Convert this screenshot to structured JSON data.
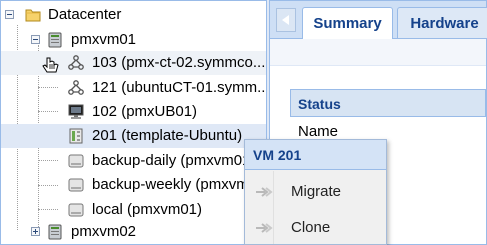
{
  "tree": {
    "datacenter": "Datacenter",
    "node1": "pmxvm01",
    "items": [
      "103 (pmx-ct-02.symmco...",
      "121 (ubuntuCT-01.symm...",
      "102 (pmxUB01)",
      "201 (template-Ubuntu)",
      "backup-daily (pmxvm01",
      "backup-weekly (pmxvm0",
      "local (pmxvm01)"
    ],
    "node2": "pmxvm02"
  },
  "tabs": [
    "Summary",
    "Hardware"
  ],
  "status": {
    "header": "Status",
    "name_label": "Name"
  },
  "context_menu": {
    "title": "VM 201",
    "items": [
      "Migrate",
      "Clone"
    ]
  },
  "colors": {
    "accent": "#15428b",
    "border": "#99bbe8",
    "selected": "#dfe8f6"
  }
}
